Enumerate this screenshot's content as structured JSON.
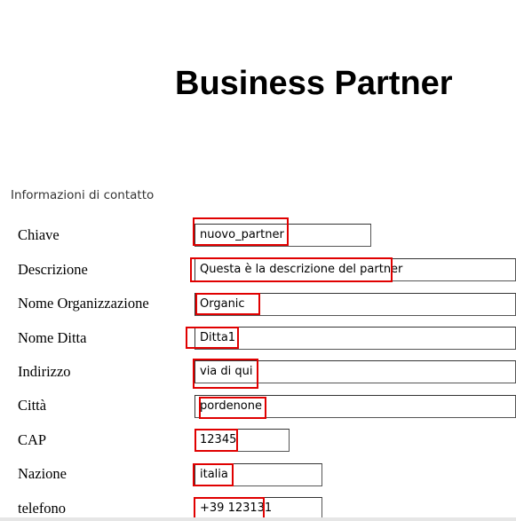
{
  "page": {
    "title": "Business Partner"
  },
  "section": {
    "title": "Informazioni di contatto"
  },
  "fields": [
    {
      "label": "Chiave",
      "value": "nuovo_partner"
    },
    {
      "label": "Descrizione",
      "value": "Questa è la descrizione del partner"
    },
    {
      "label": "Nome Organizzazione",
      "value": "Organic"
    },
    {
      "label": "Nome Ditta",
      "value": "Ditta1"
    },
    {
      "label": "Indirizzo",
      "value": "via di qui"
    },
    {
      "label": "Città",
      "value": "pordenone"
    },
    {
      "label": "CAP",
      "value": "12345"
    },
    {
      "label": "Nazione",
      "value": "italia"
    },
    {
      "label": "telefono",
      "value": "+39 123131"
    }
  ],
  "colors": {
    "highlight": "#e00000"
  }
}
